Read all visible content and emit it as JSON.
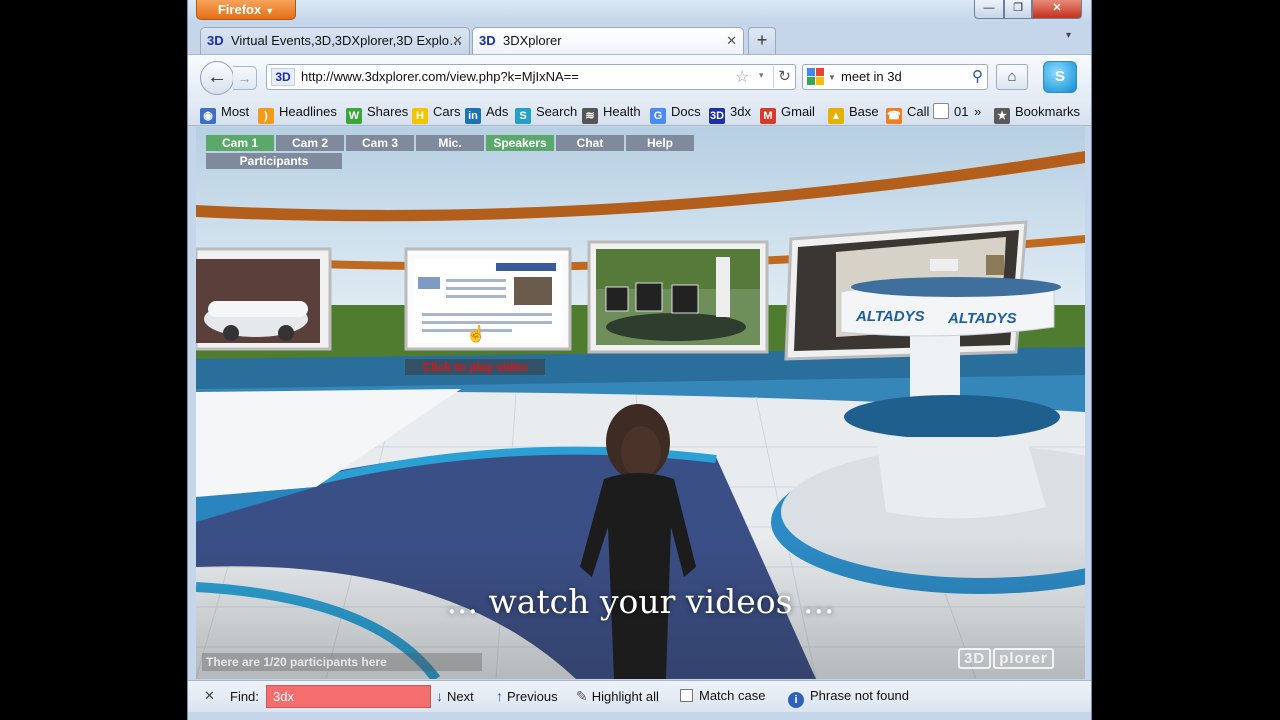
{
  "window": {
    "app_button": "Firefox",
    "min_glyph": "—",
    "max_glyph": "❐",
    "close_glyph": "✕"
  },
  "tabs": [
    {
      "favicon": "3D",
      "title": "Virtual Events,3D,3DXplorer,3D Explo…",
      "close": "✕"
    },
    {
      "favicon": "3D",
      "title": "3DXplorer",
      "close": "✕"
    }
  ],
  "new_tab": "+",
  "tab_list": "▾",
  "nav": {
    "back": "←",
    "forward": "→",
    "url_favicon": "3D",
    "url": "http://www.3dxplorer.com/view.php?k=MjIxNA==",
    "star": "☆",
    "dropmark": "▾",
    "reload": "↻",
    "search_value": "meet in 3d",
    "search_glyph": "⚲",
    "home": "⌂",
    "skype": "S"
  },
  "bookmarks": [
    {
      "label": "Most",
      "icon": "most-visited-icon",
      "color": "#3d6fc4",
      "glyph": "◉"
    },
    {
      "label": "Headlines",
      "icon": "rss-icon",
      "color": "#f39a1d",
      "glyph": ")"
    },
    {
      "label": "Shares",
      "icon": "shares-icon",
      "color": "#3aa63a",
      "glyph": "W"
    },
    {
      "label": "Cars",
      "icon": "cars-icon",
      "color": "#f3c400",
      "glyph": "H"
    },
    {
      "label": "Ads",
      "icon": "linkedin-icon",
      "color": "#1a73b5",
      "glyph": "in"
    },
    {
      "label": "Search",
      "icon": "search-site-icon",
      "color": "#22a0c8",
      "glyph": "S"
    },
    {
      "label": "Health",
      "icon": "health-icon",
      "color": "#555555",
      "glyph": "≋"
    },
    {
      "label": "Docs",
      "icon": "google-docs-icon",
      "color": "#4a8af4",
      "glyph": "G"
    },
    {
      "label": "3dx",
      "icon": "3dx-icon",
      "color": "#1b2fa8",
      "glyph": "3D"
    },
    {
      "label": "Gmail",
      "icon": "gmail-icon",
      "color": "#d93b2b",
      "glyph": "M"
    },
    {
      "label": "Base",
      "icon": "base-icon",
      "color": "#e8b000",
      "glyph": "▲"
    },
    {
      "label": "Call",
      "icon": "call-icon",
      "color": "#f07e1e",
      "glyph": "☎"
    },
    {
      "label": "01",
      "icon": "page-icon",
      "color": "#ffffff",
      "glyph": ""
    },
    {
      "label": "»",
      "icon": "chevron-more-icon",
      "color": "",
      "glyph": ""
    },
    {
      "label": "Bookmarks",
      "icon": "bookmarks-icon",
      "color": "#5a5a5a",
      "glyph": "★"
    }
  ],
  "viewer": {
    "buttons": [
      {
        "label": "Cam 1",
        "active": true
      },
      {
        "label": "Cam 2",
        "active": false
      },
      {
        "label": "Cam 3",
        "active": false
      },
      {
        "label": "Mic.",
        "active": false
      },
      {
        "label": "Speakers",
        "active": true
      },
      {
        "label": "Chat",
        "active": false
      },
      {
        "label": "Help",
        "active": false
      },
      {
        "label": "Participants",
        "active": false
      }
    ],
    "video_prompt": "Click to play video",
    "subtitle": "... watch your videos ...",
    "participants_text": "There are 1/20 participants here",
    "watermark_a": "3D",
    "watermark_b": "plorer",
    "booth_logo": "ALTADYS"
  },
  "findbar": {
    "close": "✕",
    "label": "Find:",
    "query": "3dx",
    "next": "Next",
    "next_glyph": "↓",
    "previous": "Previous",
    "previous_glyph": "↑",
    "highlight": "Highlight all",
    "highlight_glyph": "✎",
    "match_case": "Match case",
    "status_glyph": "i",
    "status": "Phrase not found"
  }
}
